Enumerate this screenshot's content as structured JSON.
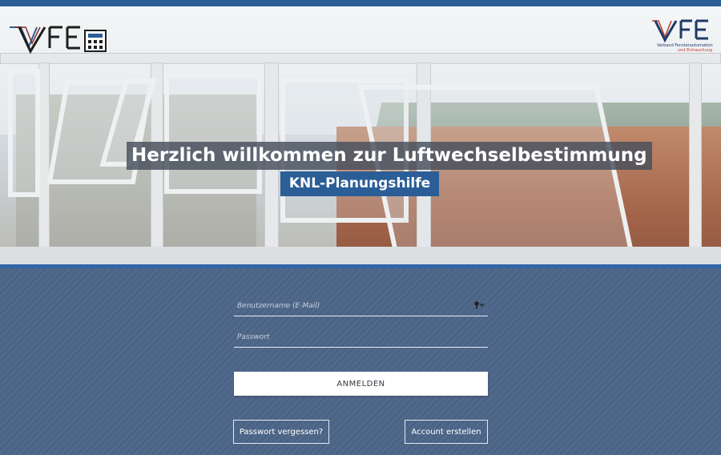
{
  "header": {
    "logo_left": {
      "name": "VFE",
      "icon": "calculator-icon",
      "color_main": "#1e1e1e",
      "color_accent": "#2b5e96"
    },
    "logo_right": {
      "name": "VFE",
      "line1": "Verband Fensterautomation",
      "line2": "und Entrauchung",
      "color_main": "#1d3a66",
      "color_accent": "#c0392b"
    }
  },
  "hero": {
    "title": "Herzlich willkommen zur Luftwechselbestimmung",
    "subtitle": "KNL-Planungshilfe",
    "title_bg": "#464e5c",
    "subtitle_bg": "#2b5e96"
  },
  "login": {
    "username_placeholder": "Benutzername (E-Mail)",
    "password_placeholder": "Passwort",
    "username_icon": "key-icon",
    "submit_label": "ANMELDEN",
    "forgot_label": "Passwort vergessen?",
    "create_label": "Account erstellen",
    "background": "#4f6a86",
    "accent": "#2f66a6"
  }
}
